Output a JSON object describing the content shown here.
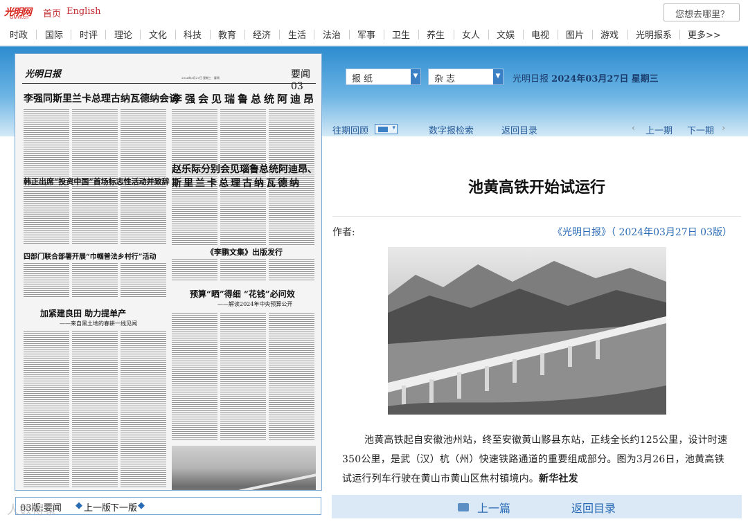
{
  "site": {
    "logo_text": "光明网",
    "logo_sub": "GMW.cn",
    "top_links": [
      "首页",
      "English"
    ],
    "search_placeholder": "您想去哪里？"
  },
  "channels": [
    "时政",
    "国际",
    "时评",
    "理论",
    "文化",
    "科技",
    "教育",
    "经济",
    "生活",
    "法治",
    "军事",
    "卫生",
    "养生",
    "女人",
    "文娱",
    "电视",
    "图片",
    "游戏",
    "光明报系",
    "更多>>"
  ],
  "paper": {
    "masthead": "光明日报",
    "dateline": "2024年3月27日 星期三 · 要闻",
    "section_label": "要闻 03",
    "headlines": [
      "李强同斯里兰卡总理古纳瓦德纳会谈",
      "李强会见瑞鲁总统阿迪昂",
      "赵乐际分别会见瑙鲁总统阿迪昂、",
      "斯里兰卡总理古纳瓦德纳",
      "韩正出席“投资中国”首场标志性活动并致辞",
      "四部门联合部署开展“巾帼普法乡村行”活动",
      "《李鹏文集》出版发行",
      "预算“晒”得细 “花钱”必问效",
      "加紧建良田 助力提单产"
    ],
    "subheads": [
      "——解读2024年中央预算公开",
      "——来自黑土地的春耕一线见闻"
    ]
  },
  "pager": {
    "current": "03版:要闻",
    "prev": "上一版",
    "next": "下一版"
  },
  "selectors": {
    "paper_label": "报纸",
    "magazine_label": "杂志"
  },
  "issue": {
    "paper_name": "光明日报",
    "date": "2024年03月27日",
    "weekday": "星期三"
  },
  "subnav": {
    "archive": "往期回顾",
    "search": "数字报检索",
    "toc": "返回目录",
    "prev_issue": "上一期",
    "next_issue": "下一期"
  },
  "article": {
    "title": "池黄高铁开始试运行",
    "author_label": "作者:",
    "source": "《光明日报》（ 2024年03月27日 03版）",
    "body": "池黄高铁起自安徽池州站，终至安徽黄山黟县东站，正线全长约125公里，设计时速350公里，是武（汉）杭（州）快速铁路通道的重要组成部分。图为3月26日，池黄高铁试运行列车行驶在黄山市黄山区焦村镇境内。",
    "credit": "新华社发"
  },
  "bottom_nav": {
    "prev_article": "上一篇",
    "back_toc": "返回目录"
  },
  "watermark": "人数得景"
}
